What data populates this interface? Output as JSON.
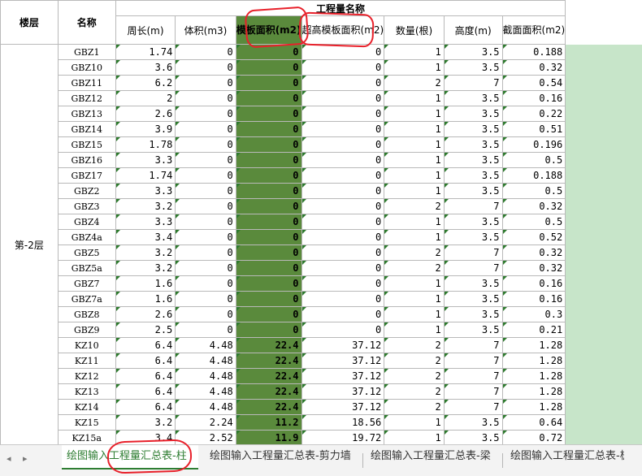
{
  "sheet": {
    "header_floor": "楼层",
    "header_name": "名称",
    "header_group": "工程量名称",
    "columns": {
      "perimeter": "周长(m)",
      "volume": "体积(m3)",
      "formwork": "模板面积(m2)",
      "high_formwork": "超高模板面积(m2)",
      "count": "数量(根)",
      "height": "高度(m)",
      "section": "截面面积(m2)"
    },
    "floor": "第-2层",
    "rows": [
      {
        "name": "GBZ1",
        "perimeter": "1.74",
        "volume": "0",
        "formwork": "0",
        "high_formwork": "0",
        "count": "1",
        "height": "3.5",
        "section": "0.188"
      },
      {
        "name": "GBZ10",
        "perimeter": "3.6",
        "volume": "0",
        "formwork": "0",
        "high_formwork": "0",
        "count": "1",
        "height": "3.5",
        "section": "0.32"
      },
      {
        "name": "GBZ11",
        "perimeter": "6.2",
        "volume": "0",
        "formwork": "0",
        "high_formwork": "0",
        "count": "2",
        "height": "7",
        "section": "0.54"
      },
      {
        "name": "GBZ12",
        "perimeter": "2",
        "volume": "0",
        "formwork": "0",
        "high_formwork": "0",
        "count": "1",
        "height": "3.5",
        "section": "0.16"
      },
      {
        "name": "GBZ13",
        "perimeter": "2.6",
        "volume": "0",
        "formwork": "0",
        "high_formwork": "0",
        "count": "1",
        "height": "3.5",
        "section": "0.22"
      },
      {
        "name": "GBZ14",
        "perimeter": "3.9",
        "volume": "0",
        "formwork": "0",
        "high_formwork": "0",
        "count": "1",
        "height": "3.5",
        "section": "0.51"
      },
      {
        "name": "GBZ15",
        "perimeter": "1.78",
        "volume": "0",
        "formwork": "0",
        "high_formwork": "0",
        "count": "1",
        "height": "3.5",
        "section": "0.196"
      },
      {
        "name": "GBZ16",
        "perimeter": "3.3",
        "volume": "0",
        "formwork": "0",
        "high_formwork": "0",
        "count": "1",
        "height": "3.5",
        "section": "0.5"
      },
      {
        "name": "GBZ17",
        "perimeter": "1.74",
        "volume": "0",
        "formwork": "0",
        "high_formwork": "0",
        "count": "1",
        "height": "3.5",
        "section": "0.188"
      },
      {
        "name": "GBZ2",
        "perimeter": "3.3",
        "volume": "0",
        "formwork": "0",
        "high_formwork": "0",
        "count": "1",
        "height": "3.5",
        "section": "0.5"
      },
      {
        "name": "GBZ3",
        "perimeter": "3.2",
        "volume": "0",
        "formwork": "0",
        "high_formwork": "0",
        "count": "2",
        "height": "7",
        "section": "0.32"
      },
      {
        "name": "GBZ4",
        "perimeter": "3.3",
        "volume": "0",
        "formwork": "0",
        "high_formwork": "0",
        "count": "1",
        "height": "3.5",
        "section": "0.5"
      },
      {
        "name": "GBZ4a",
        "perimeter": "3.4",
        "volume": "0",
        "formwork": "0",
        "high_formwork": "0",
        "count": "1",
        "height": "3.5",
        "section": "0.52"
      },
      {
        "name": "GBZ5",
        "perimeter": "3.2",
        "volume": "0",
        "formwork": "0",
        "high_formwork": "0",
        "count": "2",
        "height": "7",
        "section": "0.32"
      },
      {
        "name": "GBZ5a",
        "perimeter": "3.2",
        "volume": "0",
        "formwork": "0",
        "high_formwork": "0",
        "count": "2",
        "height": "7",
        "section": "0.32"
      },
      {
        "name": "GBZ7",
        "perimeter": "1.6",
        "volume": "0",
        "formwork": "0",
        "high_formwork": "0",
        "count": "1",
        "height": "3.5",
        "section": "0.16"
      },
      {
        "name": "GBZ7a",
        "perimeter": "1.6",
        "volume": "0",
        "formwork": "0",
        "high_formwork": "0",
        "count": "1",
        "height": "3.5",
        "section": "0.16"
      },
      {
        "name": "GBZ8",
        "perimeter": "2.6",
        "volume": "0",
        "formwork": "0",
        "high_formwork": "0",
        "count": "1",
        "height": "3.5",
        "section": "0.3"
      },
      {
        "name": "GBZ9",
        "perimeter": "2.5",
        "volume": "0",
        "formwork": "0",
        "high_formwork": "0",
        "count": "1",
        "height": "3.5",
        "section": "0.21"
      },
      {
        "name": "KZ10",
        "perimeter": "6.4",
        "volume": "4.48",
        "formwork": "22.4",
        "high_formwork": "37.12",
        "count": "2",
        "height": "7",
        "section": "1.28"
      },
      {
        "name": "KZ11",
        "perimeter": "6.4",
        "volume": "4.48",
        "formwork": "22.4",
        "high_formwork": "37.12",
        "count": "2",
        "height": "7",
        "section": "1.28"
      },
      {
        "name": "KZ12",
        "perimeter": "6.4",
        "volume": "4.48",
        "formwork": "22.4",
        "high_formwork": "37.12",
        "count": "2",
        "height": "7",
        "section": "1.28"
      },
      {
        "name": "KZ13",
        "perimeter": "6.4",
        "volume": "4.48",
        "formwork": "22.4",
        "high_formwork": "37.12",
        "count": "2",
        "height": "7",
        "section": "1.28"
      },
      {
        "name": "KZ14",
        "perimeter": "6.4",
        "volume": "4.48",
        "formwork": "22.4",
        "high_formwork": "37.12",
        "count": "2",
        "height": "7",
        "section": "1.28"
      },
      {
        "name": "KZ15",
        "perimeter": "3.2",
        "volume": "2.24",
        "formwork": "11.2",
        "high_formwork": "18.56",
        "count": "1",
        "height": "3.5",
        "section": "0.64"
      },
      {
        "name": "KZ15a",
        "perimeter": "3.4",
        "volume": "2.52",
        "formwork": "11.9",
        "high_formwork": "19.72",
        "count": "1",
        "height": "3.5",
        "section": "0.72"
      }
    ]
  },
  "tabs": {
    "nav_prev": "◂",
    "nav_next": "▸",
    "items": [
      {
        "label": "绘图输入工程量汇总表-柱",
        "active": true
      },
      {
        "label": "绘图输入工程量汇总表-剪力墙",
        "active": false
      },
      {
        "label": "绘图输入工程量汇总表-梁",
        "active": false
      },
      {
        "label": "绘图输入工程量汇总表-板",
        "active": false
      }
    ]
  },
  "colors": {
    "highlight_column": "#5a8a3c",
    "annotation": "#e8202a",
    "active_tab": "#2e7d32",
    "pad_area": "#c7e5c9"
  }
}
